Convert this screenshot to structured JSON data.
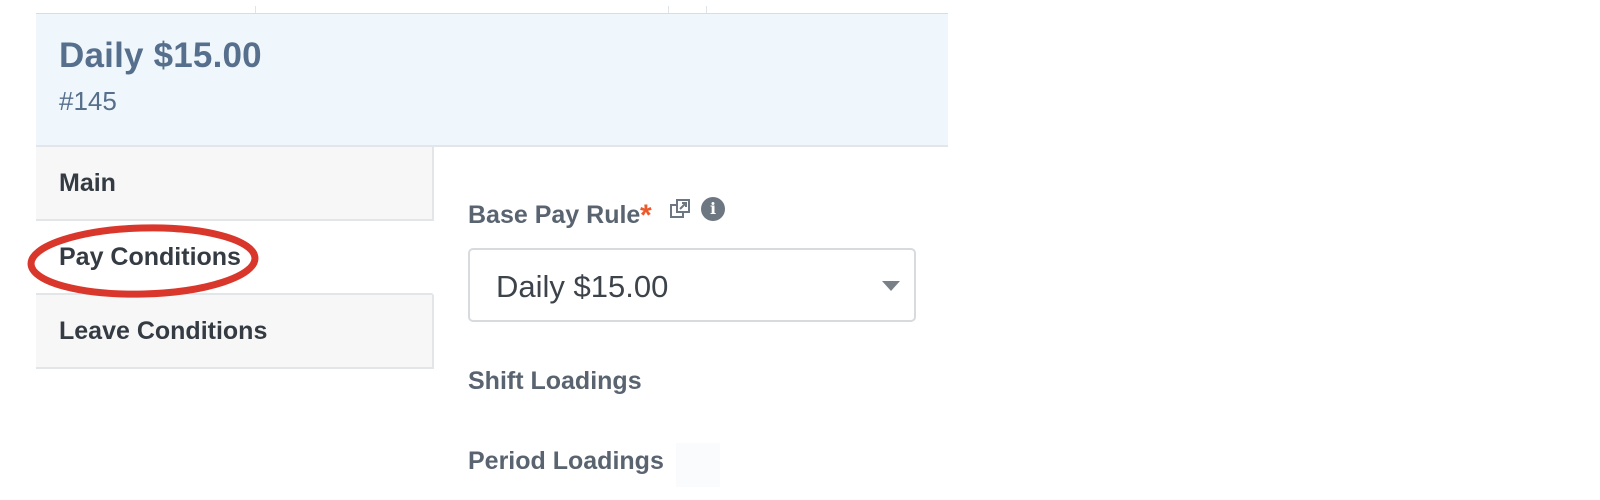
{
  "header": {
    "title": "Daily $15.00",
    "id_label": "#145"
  },
  "tabs": [
    {
      "label": "Main",
      "active": false
    },
    {
      "label": "Pay Conditions",
      "active": true,
      "highlighted": true
    },
    {
      "label": "Leave Conditions",
      "active": false
    }
  ],
  "form": {
    "base_pay_rule_label": "Base Pay Rule",
    "required_marker": "*",
    "required_color": "#ec5a2c",
    "external_link_icon": "external-link-icon",
    "info_icon": "info-icon",
    "info_glyph": "i",
    "base_pay_rule_value": "Daily $15.00",
    "shift_loadings_label": "Shift Loadings",
    "period_loadings_label": "Period Loadings"
  },
  "colors": {
    "header_bg": "#f0f7fc",
    "header_text": "#566f8c",
    "highlight_ring": "#d9372b"
  }
}
